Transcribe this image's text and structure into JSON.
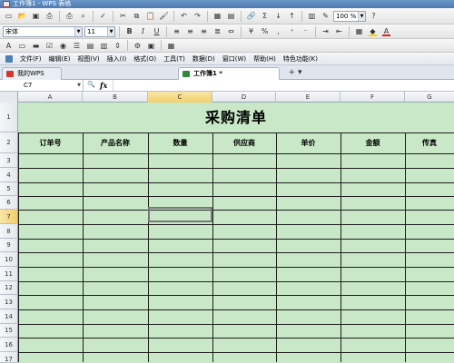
{
  "window": {
    "title": "工作簿1 - WPS 表格"
  },
  "toolbar_format": {
    "font_name": "宋体",
    "font_size": "11",
    "bold": "B",
    "italic": "I",
    "underline": "U"
  },
  "toolbar_standard": {
    "zoom": "100 %"
  },
  "menu": {
    "items": [
      "文件(F)",
      "编辑(E)",
      "视图(V)",
      "插入(I)",
      "格式(O)",
      "工具(T)",
      "数据(D)",
      "窗口(W)",
      "帮助(H)",
      "特色功能(K)"
    ]
  },
  "tabs": {
    "home": "我的WPS",
    "book": "工作簿1 *",
    "add": "+"
  },
  "formula_bar": {
    "cell_ref": "C7",
    "fx": "fx",
    "value": ""
  },
  "sheet": {
    "columns": [
      "A",
      "B",
      "C",
      "D",
      "E",
      "F",
      "G"
    ],
    "rows": [
      "1",
      "2",
      "3",
      "4",
      "5",
      "6",
      "7",
      "8",
      "9",
      "10",
      "11",
      "12",
      "13",
      "14",
      "15",
      "16",
      "17"
    ],
    "title": "采购清单",
    "headers": [
      "订单号",
      "产品名称",
      "数量",
      "供应商",
      "单价",
      "金额",
      "传真"
    ],
    "selected_cell": "C7"
  },
  "colors": {
    "sheet_bg": "#c9e8c8",
    "grid_line": "#1e1e1e",
    "selection_header": "#f2cf6a"
  }
}
